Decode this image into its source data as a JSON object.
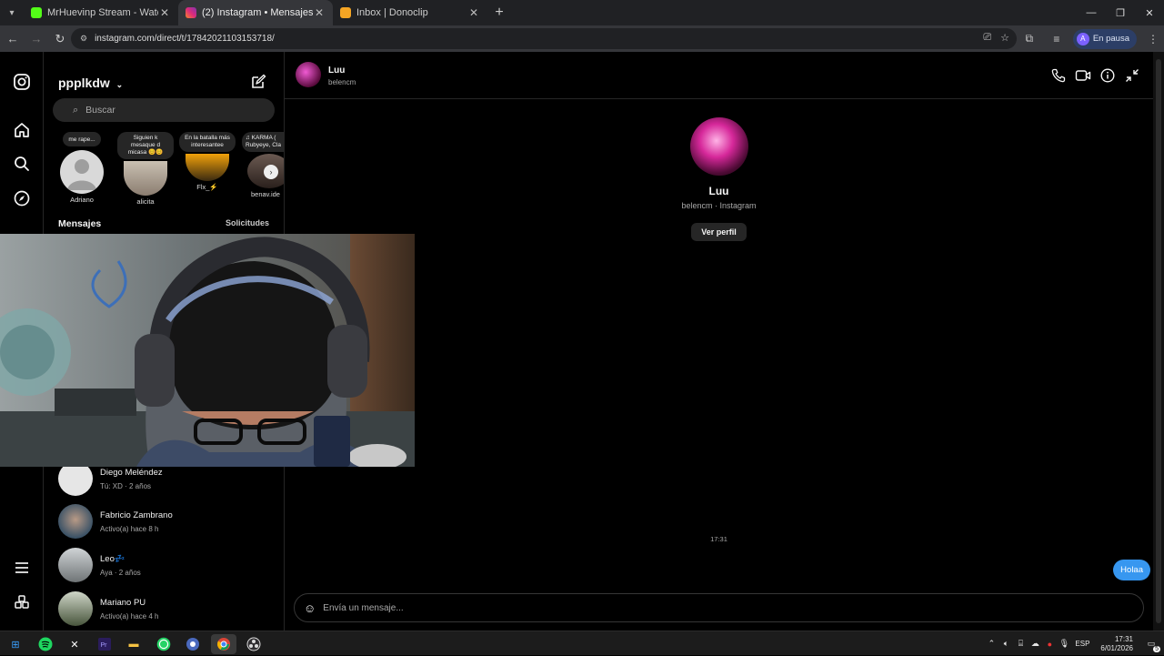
{
  "browser": {
    "tabs": [
      {
        "title": "MrHuevinp Stream - Watch Live",
        "favicon_color": "#53fc18",
        "active": false
      },
      {
        "title": "(2) Instagram • Mensajes",
        "favicon_color": "#e1306c",
        "active": true
      },
      {
        "title": "Inbox | Donoclip",
        "favicon_color": "#f5a524",
        "active": false
      }
    ],
    "url": "instagram.com/direct/t/17842021103153718/",
    "profile_initial": "A",
    "profile_status": "En pausa"
  },
  "inbox": {
    "username": "ppplkdw",
    "search_placeholder": "Buscar",
    "notes": [
      {
        "note": "me rape...",
        "name": "Adriano"
      },
      {
        "note": "Siguien k mesaque d micasa 😊😊",
        "name": "alicita"
      },
      {
        "note": "En la batalla más interesantee",
        "name": "Flx_⚡"
      },
      {
        "note": "♫ KARMA ( Rubyeye, Cla",
        "name": "benav.ide"
      }
    ],
    "messages_heading": "Mensajes",
    "requests_label": "Solicitudes",
    "conversations": [
      {
        "name": "Diego Meléndez",
        "meta": "Tú: XD · 2 años",
        "avatar_color": "#e6e6e6"
      },
      {
        "name": "Fabricio Zambrano",
        "meta": "Activo(a) hace 8 h",
        "avatar_color": "#6c8fa7"
      },
      {
        "name": "Leo💤",
        "meta": "Aya · 2 años",
        "avatar_color": "#9da3a6"
      },
      {
        "name": "Mariano PU",
        "meta": "Activo(a) hace 4 h",
        "avatar_color": "#5d6b52"
      }
    ]
  },
  "chat": {
    "name": "Luu",
    "username": "belencm",
    "profile_sub": "belencm · Instagram",
    "view_profile_label": "Ver perfil",
    "timestamp": "17:31",
    "sent_message": "Holaa",
    "composer_placeholder": "Envía un mensaje..."
  },
  "taskbar": {
    "language": "ESP",
    "time": "17:31",
    "date": "6/01/2026",
    "notification_count": "5"
  }
}
